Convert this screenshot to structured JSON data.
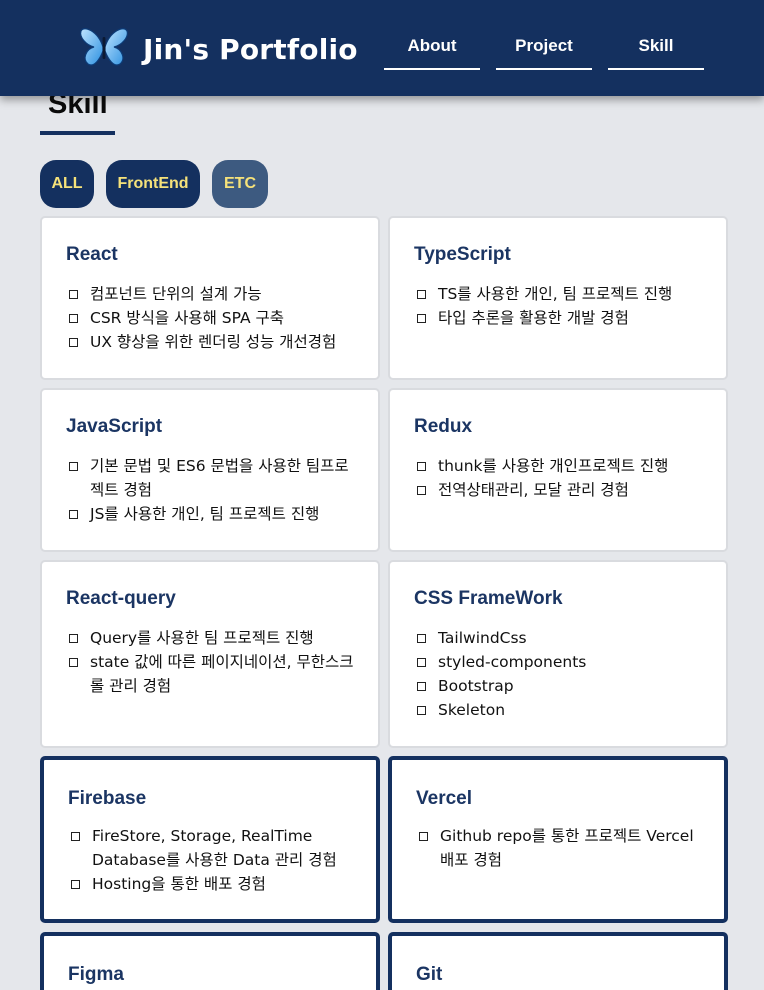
{
  "header": {
    "brand": "Jin's Portfolio",
    "logo_icon": "butterfly-icon",
    "nav": [
      {
        "label": "About"
      },
      {
        "label": "Project"
      },
      {
        "label": "Skill"
      }
    ]
  },
  "section": {
    "title": "Skill"
  },
  "filters": [
    {
      "label": "ALL"
    },
    {
      "label": "FrontEnd"
    },
    {
      "label": "ETC"
    }
  ],
  "cards": [
    {
      "title": "React",
      "items": [
        "컴포넌트 단위의 설계 가능",
        "CSR 방식을 사용해 SPA 구축",
        "UX 향상을 위한 렌더링 성능 개선경험"
      ]
    },
    {
      "title": "TypeScript",
      "items": [
        "TS를 사용한 개인, 팀 프로젝트 진행",
        "타입 추론을 활용한 개발 경험"
      ]
    },
    {
      "title": "JavaScript",
      "items": [
        "기본 문법 및 ES6 문법을 사용한 팀프로젝트 경험",
        "JS를 사용한 개인, 팀 프로젝트 진행"
      ]
    },
    {
      "title": "Redux",
      "items": [
        "thunk를 사용한 개인프로젝트 진행",
        "전역상태관리, 모달 관리 경험"
      ]
    },
    {
      "title": "React-query",
      "items": [
        "Query를 사용한 팀 프로젝트 진행",
        "state 값에 따른 페이지네이션, 무한스크롤 관리 경험"
      ]
    },
    {
      "title": "CSS FrameWork",
      "items": [
        "TailwindCss",
        "styled-components",
        "Bootstrap",
        "Skeleton"
      ]
    },
    {
      "title": "Firebase",
      "items": [
        "FireStore, Storage, RealTime Database를 사용한 Data 관리 경험",
        "Hosting을 통한 배포 경험"
      ]
    },
    {
      "title": "Vercel",
      "items": [
        "Github repo를 통한 프로젝트 Vercel 배포 경험"
      ]
    },
    {
      "title": "Figma",
      "items": []
    },
    {
      "title": "Git",
      "items": []
    }
  ],
  "colors": {
    "navy": "#14305f",
    "accent_text": "#f6e27a",
    "etc_button": "#3d5a80"
  }
}
